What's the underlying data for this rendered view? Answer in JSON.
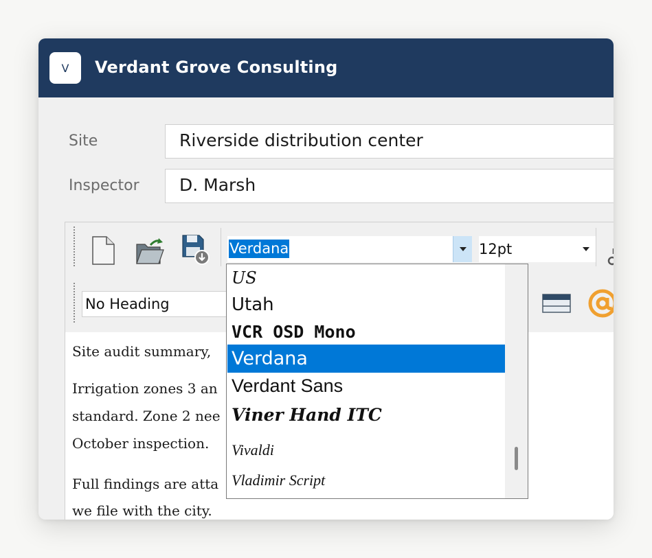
{
  "app": {
    "logo_letter": "V",
    "title": "Verdant Grove Consulting"
  },
  "form": {
    "site_label": "Site",
    "site_value": "Riverside distribution center",
    "inspector_label": "Inspector",
    "inspector_value": "D. Marsh"
  },
  "toolbar": {
    "font_value": "Verdana",
    "size_value": "12pt",
    "heading_value": "No Heading",
    "icons": [
      "new-document-icon",
      "open-folder-icon",
      "save-icon",
      "table-icon",
      "at-sign-icon"
    ]
  },
  "font_dropdown": {
    "items": [
      {
        "label": "US"
      },
      {
        "label": "Utah"
      },
      {
        "label": "VCR OSD Mono"
      },
      {
        "label": "Verdana",
        "selected": true
      },
      {
        "label": "Verdant Sans"
      },
      {
        "label": "Viner Hand ITC"
      },
      {
        "label": "Vivaldi"
      },
      {
        "label": "Vladimir Script"
      }
    ]
  },
  "document": {
    "lines": [
      "Site audit summary,",
      "Irrigation zones 3 an",
      "standard. Zone 2 nee",
      "October inspection.",
      "Full findings are atta",
      "we file with the city."
    ]
  },
  "colors": {
    "titlebar": "#1f3a5f",
    "selection": "#0078d7",
    "at_icon": "#f0a030"
  }
}
